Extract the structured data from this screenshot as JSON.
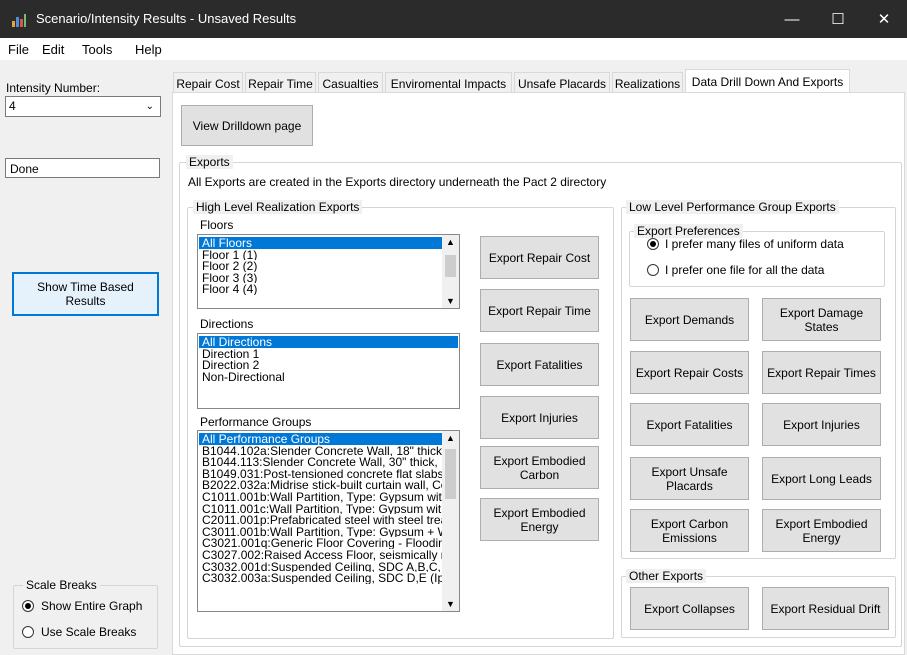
{
  "window": {
    "title": "Scenario/Intensity Results - Unsaved Results",
    "minimize": "—",
    "maximize": "☐",
    "close": "✕"
  },
  "menu": [
    "File",
    "Edit",
    "Tools",
    "Help"
  ],
  "left": {
    "intensity_label": "Intensity Number:",
    "intensity_value": "4",
    "status_value": "Done",
    "show_time_based": "Show Time Based Results",
    "scale_breaks_title": "Scale Breaks",
    "scale_opt1": "Show Entire Graph",
    "scale_opt2": "Use Scale Breaks"
  },
  "tabs": [
    "Repair Cost",
    "Repair Time",
    "Casualties",
    "Enviromental Impacts",
    "Unsafe Placards",
    "Realizations",
    "Data Drill Down And Exports"
  ],
  "drill": {
    "view_drilldown": "View Drilldown page",
    "exports_title": "Exports",
    "exports_note": "All Exports are created in the Exports directory underneath the Pact 2 directory",
    "high_level_title": "High Level Realization Exports",
    "floors_label": "Floors",
    "floors": [
      "All Floors",
      "Floor 1 (1)",
      "Floor 2 (2)",
      "Floor 3 (3)",
      "Floor 4 (4)"
    ],
    "directions_label": "Directions",
    "directions": [
      "All Directions",
      "Direction 1",
      "Direction 2",
      "Non-Directional"
    ],
    "pg_label": "Performance Groups",
    "performance_groups": [
      "All Performance Groups",
      "B1044.102a:Slender Concrete Wall, 18\" thick",
      "B1044.113:Slender Concrete Wall, 30\" thick,",
      "B1049.031:Post-tensioned concrete flat slabs",
      "B2022.032a:Midrise stick-built curtain wall, Co",
      "C1011.001b:Wall Partition, Type: Gypsum wit",
      "C1011.001c:Wall Partition, Type: Gypsum wit",
      "C2011.001p:Prefabricated steel with steel trea",
      "C3011.001b:Wall Partition, Type: Gypsum + W",
      "C3021.001q:Generic Floor Covering - Flooding",
      "C3027.002:Raised Access Floor, seismically ra",
      "C3032.001d:Suspended Ceiling, SDC A,B,C, A",
      "C3032.003a:Suspended Ceiling, SDC D,E (Ip="
    ],
    "middle_buttons": [
      "Export Repair Cost",
      "Export Repair Time",
      "Export Fatalities",
      "Export Injuries",
      "Export Embodied Carbon",
      "Export Embodied Energy"
    ],
    "low_level_title": "Low Level Performance Group Exports",
    "prefs_title": "Export Preferences",
    "pref1": "I prefer many files of uniform data",
    "pref2": "I prefer one file for all the data",
    "low_buttons": [
      "Export Demands",
      "Export Damage States",
      "Export Repair Costs",
      "Export Repair Times",
      "Export Fatalities",
      "Export Injuries",
      "Export Unsafe Placards",
      "Export Long Leads",
      "Export Carbon Emissions",
      "Export Embodied Energy"
    ],
    "other_title": "Other Exports",
    "other_buttons": [
      "Export Collapses",
      "Export Residual Drift"
    ]
  }
}
